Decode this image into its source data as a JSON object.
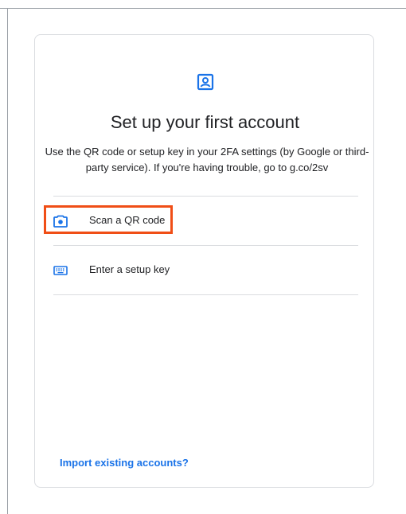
{
  "title": "Set up your first account",
  "description": "Use the QR code or setup key in your 2FA settings (by Google or third-party service). If you're having trouble, go to g.co/2sv",
  "options": [
    {
      "label": "Scan a QR code",
      "icon": "camera-icon"
    },
    {
      "label": "Enter a setup key",
      "icon": "keyboard-icon"
    }
  ],
  "import_link": "Import existing accounts?",
  "header_icon": "account-box-icon",
  "colors": {
    "accent": "#1a73e8",
    "highlight": "#f04e16",
    "divider": "#dadce0",
    "text": "#202124"
  }
}
